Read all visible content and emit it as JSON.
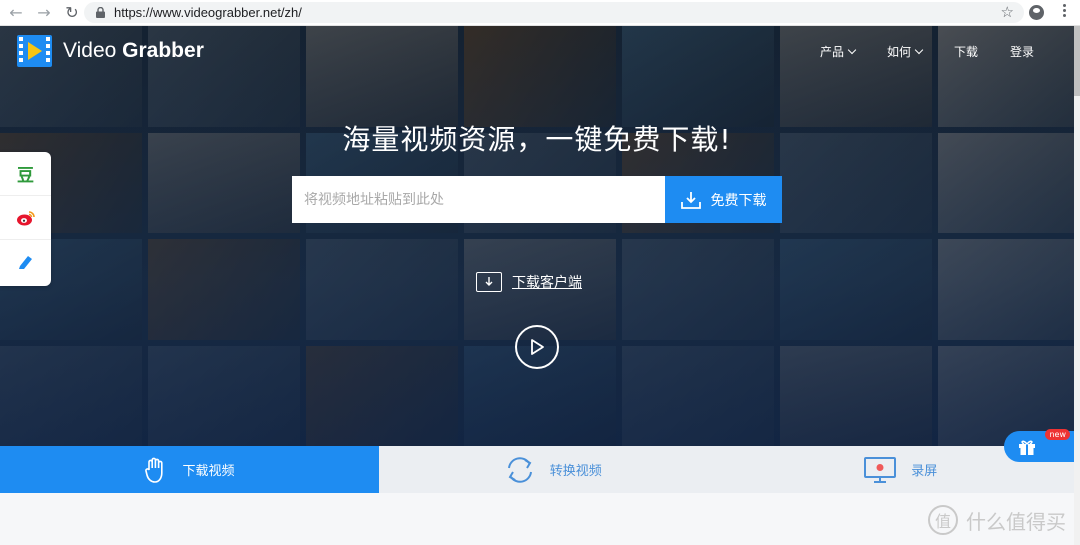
{
  "browser": {
    "url": "https://www.videograbber.net/zh/"
  },
  "brand": {
    "name_regular": "Video ",
    "name_bold": "Grabber"
  },
  "nav": {
    "products": "产品",
    "howto": "如何",
    "download": "下载",
    "login": "登录"
  },
  "hero": {
    "headline": "海量视频资源，一键免费下载!",
    "search_placeholder": "将视频地址粘贴到此处",
    "download_button": "免费下载",
    "client_link": "下载客户端"
  },
  "sidebar": {
    "douban": "豆"
  },
  "tabs": [
    {
      "label": "下载视频"
    },
    {
      "label": "转换视频"
    },
    {
      "label": "录屏"
    }
  ],
  "gift": {
    "badge": "new"
  },
  "watermark": {
    "text": "什么值得买",
    "mark": "值"
  },
  "colors": {
    "accent": "#1e8cf2",
    "tab_inactive_bg": "#ebeef2"
  }
}
